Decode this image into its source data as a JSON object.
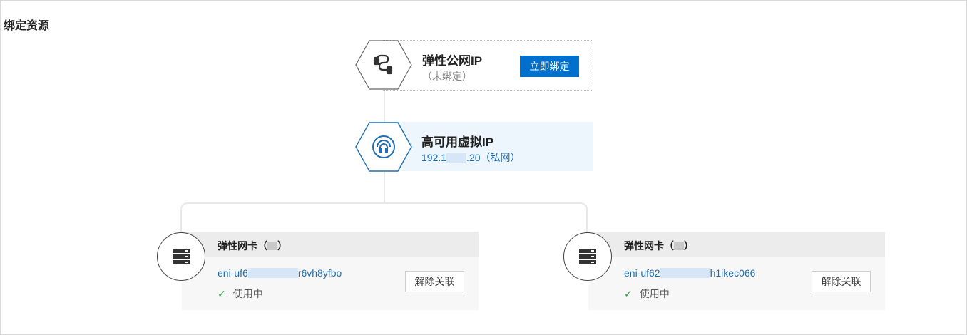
{
  "section": {
    "title": "绑定资源"
  },
  "eip": {
    "title": "弹性公网IP",
    "subtitle": "（未绑定）",
    "bind_label": "立即绑定",
    "icon": "link-icon"
  },
  "vip": {
    "title": "高可用虚拟IP",
    "address_prefix": "192.1",
    "address_suffix": ".20（私网）",
    "icon": "wifi-icon"
  },
  "enis": [
    {
      "title": "弹性网卡",
      "paren_open": "（",
      "paren_close": "）",
      "id_prefix": "eni-uf6",
      "id_suffix": "r6vh8yfbo",
      "status": "使用中",
      "unbind_label": "解除关联",
      "icon": "server-icon"
    },
    {
      "title": "弹性网卡",
      "paren_open": "（",
      "paren_close": "）",
      "id_prefix": "eni-uf62",
      "id_suffix": "h1ikec066",
      "status": "使用中",
      "unbind_label": "解除关联",
      "icon": "server-icon"
    }
  ],
  "colors": {
    "primary": "#0070cc",
    "link": "#1f6fb3",
    "vip_bg": "#eef6fd",
    "hex_blue": "#1f6fb3",
    "hex_gray": "#666666"
  }
}
